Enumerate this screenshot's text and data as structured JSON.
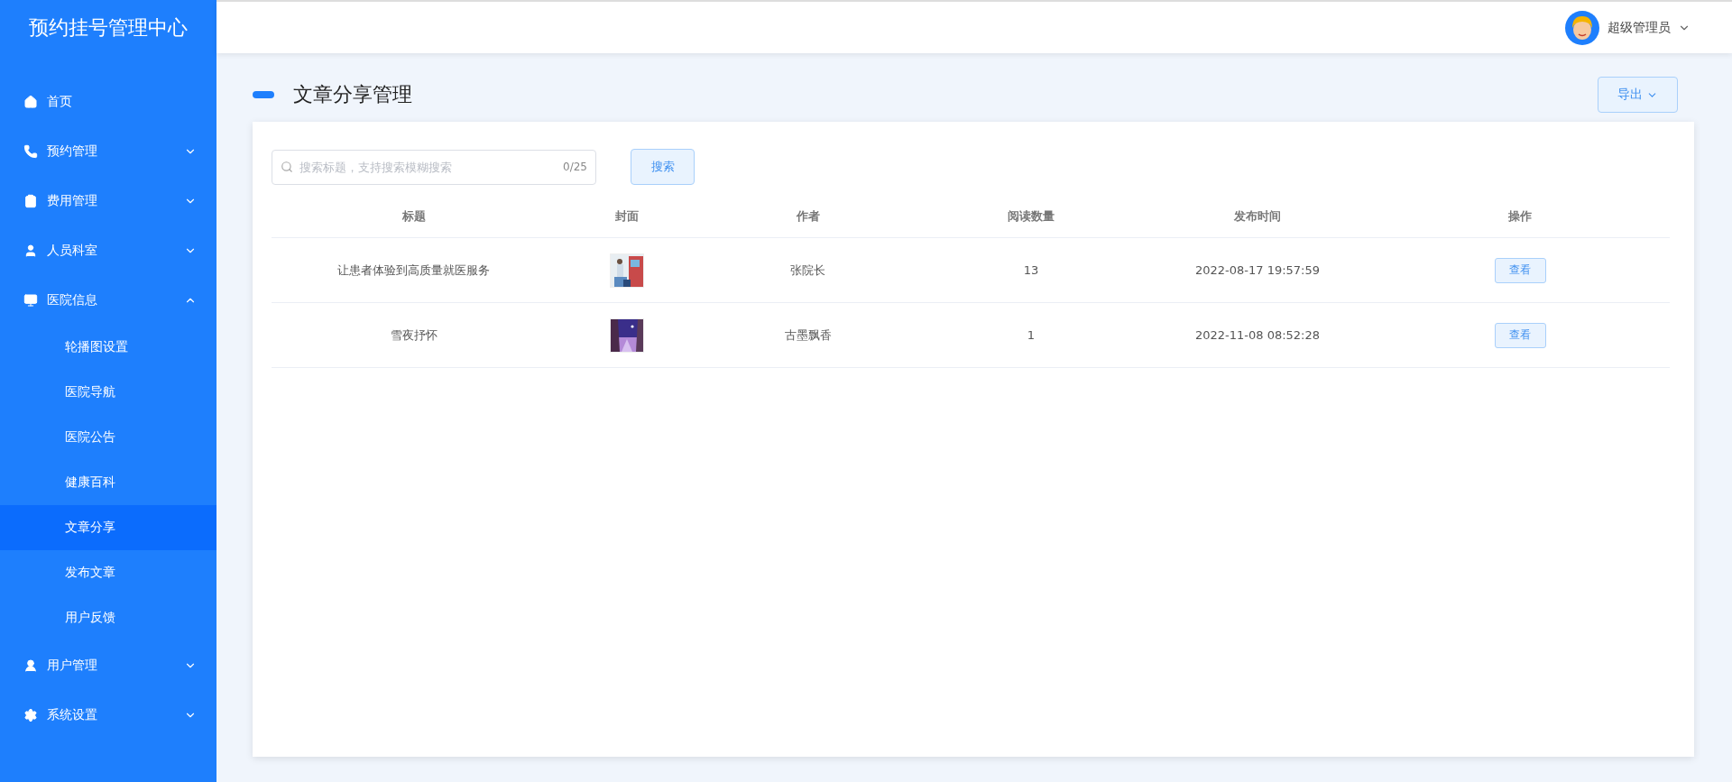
{
  "sidebar": {
    "title": "预约挂号管理中心",
    "items": [
      {
        "label": "首页"
      },
      {
        "label": "预约管理",
        "expanded": false
      },
      {
        "label": "费用管理",
        "expanded": false
      },
      {
        "label": "人员科室",
        "expanded": false
      },
      {
        "label": "医院信息",
        "expanded": true,
        "children": [
          {
            "label": "轮播图设置",
            "selected": false
          },
          {
            "label": "医院导航",
            "selected": false
          },
          {
            "label": "医院公告",
            "selected": false
          },
          {
            "label": "健康百科",
            "selected": false
          },
          {
            "label": "文章分享",
            "selected": true
          },
          {
            "label": "发布文章",
            "selected": false
          },
          {
            "label": "用户反馈",
            "selected": false
          }
        ]
      },
      {
        "label": "用户管理",
        "expanded": false
      },
      {
        "label": "系统设置",
        "expanded": false
      }
    ]
  },
  "header": {
    "user": "超级管理员"
  },
  "page": {
    "title": "文章分享管理",
    "export_button": "导出"
  },
  "search": {
    "placeholder": "搜索标题，支持搜索模糊搜索",
    "counter": "0/25",
    "button": "搜索"
  },
  "table": {
    "columns": [
      "标题",
      "封面",
      "作者",
      "阅读数量",
      "发布时间",
      "操作"
    ],
    "rows": [
      {
        "title": "让患者体验到高质量就医服务",
        "author": "张院长",
        "reads": "13",
        "published": "2022-08-17 19:57:59",
        "action": "查看"
      },
      {
        "title": "雪夜抒怀",
        "author": "古墨飘香",
        "reads": "1",
        "published": "2022-11-08 08:52:28",
        "action": "查看"
      }
    ]
  }
}
